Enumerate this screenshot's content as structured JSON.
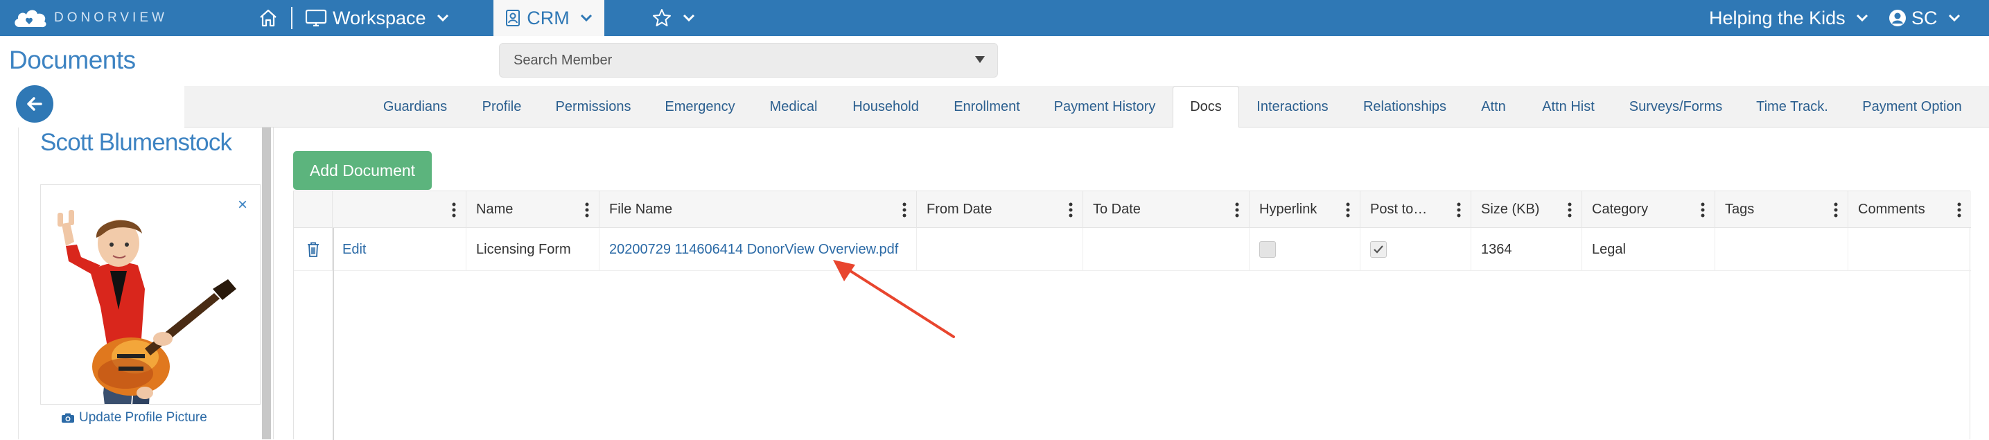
{
  "brand": {
    "logo_text": "DONORVIEW"
  },
  "topnav": {
    "workspace_label": "Workspace",
    "crm_label": "CRM",
    "org_label": "Helping the Kids",
    "user_initials": "SC"
  },
  "page": {
    "title": "Documents",
    "search_placeholder": "Search Member"
  },
  "subtabs": [
    {
      "label": "Guardians",
      "active": false
    },
    {
      "label": "Profile",
      "active": false
    },
    {
      "label": "Permissions",
      "active": false
    },
    {
      "label": "Emergency",
      "active": false
    },
    {
      "label": "Medical",
      "active": false
    },
    {
      "label": "Household",
      "active": false
    },
    {
      "label": "Enrollment",
      "active": false
    },
    {
      "label": "Payment History",
      "active": false
    },
    {
      "label": "Docs",
      "active": true
    },
    {
      "label": "Interactions",
      "active": false
    },
    {
      "label": "Relationships",
      "active": false
    },
    {
      "label": "Attn",
      "active": false
    },
    {
      "label": "Attn Hist",
      "active": false
    },
    {
      "label": "Surveys/Forms",
      "active": false
    },
    {
      "label": "Time Track.",
      "active": false
    },
    {
      "label": "Payment Option",
      "active": false
    }
  ],
  "member": {
    "name": "Scott Blumenstock",
    "close_glyph": "×",
    "update_picture_label": "Update Profile Picture"
  },
  "documents": {
    "add_button_label": "Add Document",
    "columns": [
      "",
      "Name",
      "File Name",
      "From Date",
      "To Date",
      "Hyperlink",
      "Post to…",
      "Size (KB)",
      "Category",
      "Tags",
      "Comments"
    ],
    "rows": [
      {
        "action": "Edit",
        "name": "Licensing Form",
        "file_name": "20200729 114606414 DonorView Overview.pdf",
        "from_date": "",
        "to_date": "",
        "hyperlink": false,
        "post_to": true,
        "size_kb": "1364",
        "category": "Legal",
        "tags": "",
        "comments": ""
      }
    ]
  },
  "colors": {
    "nav_blue": "#2f78b5",
    "title_blue": "#3d83c2",
    "link_blue": "#2b6aa6",
    "add_button_green": "#5cb47d",
    "annotation_arrow": "#e8452e"
  },
  "icons": [
    "home-icon",
    "monitor-icon",
    "chevron-down-icon",
    "crm-icon",
    "star-icon",
    "user-circle-icon",
    "back-arrow-icon",
    "search-caret-icon",
    "kebab-icon",
    "trash-icon",
    "checkmark-icon",
    "camera-icon",
    "close-icon"
  ]
}
